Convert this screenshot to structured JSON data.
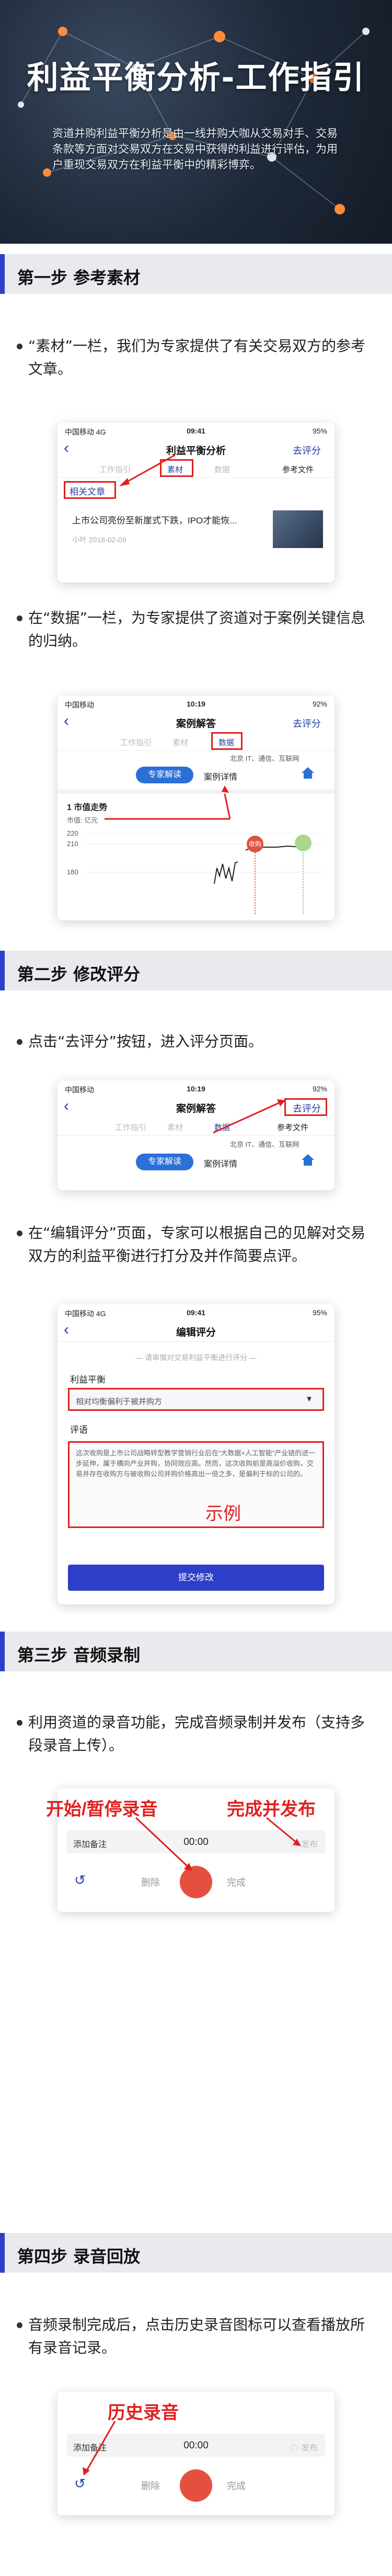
{
  "hero": {
    "title": "利益平衡分析-工作指引",
    "description": "资道并购利益平衡分析是由一线并购大咖从交易对手、交易条款等方面对交易双方在交易中获得的利益进行评估，为用户重现交易双方在利益平衡中的精彩博弈。"
  },
  "step1": {
    "heading": "第一步  参考素材",
    "bullet1": "“素材”一栏，我们为专家提供了有关交易双方的参考文章。",
    "bullet2": "在“数据”一栏，为专家提供了资道对于案例关键信息的归纳。"
  },
  "shot1": {
    "carrier": "中国移动  4G",
    "time": "09:41",
    "battery": "95%",
    "title": "利益平衡分析",
    "action": "去评分",
    "tabs": [
      "工作指引",
      "素材",
      "数据",
      "参考文件"
    ],
    "section": "相关文章",
    "article_title": "上市公司亮份至新崖式下跌，IPO才能恢...",
    "article_meta": "小叶  2018-02-09"
  },
  "shot2": {
    "carrier": "中国移动",
    "time": "10:19",
    "battery": "92%",
    "title": "案例解答",
    "action": "去评分",
    "tabs": [
      "工作指引",
      "素材",
      "数据"
    ],
    "tags": "北京  IT、通信、互联网",
    "btn_expert": "专家解读",
    "btn_detail": "案例详情",
    "chart_title": "1 市值走势",
    "chart_unit": "市值: 亿元",
    "ticks": [
      "220",
      "210",
      "180"
    ],
    "marker": "收购"
  },
  "step2": {
    "heading": "第二步  修改评分",
    "bullet1": "点击“去评分”按钮，进入评分页面。",
    "bullet2": "在“编辑评分”页面，专家可以根据自己的见解对交易双方的利益平衡进行打分及并作简要点评。"
  },
  "shot3": {
    "carrier": "中国移动",
    "time": "10:19",
    "battery": "92%",
    "title": "案例解答",
    "action": "去评分",
    "tabs": [
      "工作指引",
      "素材",
      "数据",
      "参考文件"
    ],
    "tags": "北京  IT、通信、互联网",
    "btn_expert": "专家解读",
    "btn_detail": "案例详情"
  },
  "shot4": {
    "carrier": "中国移动  4G",
    "time": "09:41",
    "battery": "95%",
    "title": "编辑评分",
    "hint": "请审慎对交易利益平衡进行评分",
    "label1": "利益平衡",
    "select_value": "相对均衡偏利于被并购方",
    "label2": "评语",
    "comment": "这次收购是上市公司战略转型教学营销行业后在“大数据+人工智能”产业链的进一步延伸，属于横向产业并购，协同效应高。然而，这次收购前是高溢价收购，交易并存在收购方与被收购公司并购价格高出一倍之多，是偏利于标的公司的。",
    "example": "示例",
    "submit": "提交修改"
  },
  "step3": {
    "heading": "第三步  音频录制",
    "bullet1": "利用资道的录音功能，完成音频录制并发布（支持多段录音上传）。"
  },
  "rec1": {
    "ann_start": "开始/暂停录音",
    "ann_finish": "完成并发布",
    "add_note": "添加备注",
    "time": "00:00",
    "publish": "发布",
    "delete": "删除",
    "done": "完成"
  },
  "step4": {
    "heading": "第四步  录音回放",
    "bullet1": "音频录制完成后，点击历史录音图标可以查看播放所有录音记录。"
  },
  "rec2": {
    "ann_history": "历史录音",
    "add_note": "添加备注",
    "time": "00:00",
    "publish": "发布",
    "delete": "删除",
    "done": "完成"
  },
  "colors": {
    "accent": "#2d3ec8",
    "annotation": "#e02020",
    "brand_blue": "#2340a8",
    "record": "#e3503f"
  }
}
